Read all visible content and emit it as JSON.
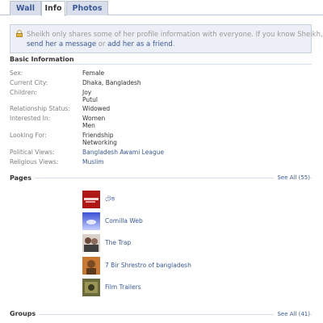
{
  "tabs": [
    {
      "label": "Wall"
    },
    {
      "label": "Info"
    },
    {
      "label": "Photos"
    }
  ],
  "notice": {
    "line1": "Sheikh only shares some of her profile information with everyone. If you know Sheikh,",
    "send_message": "send her a message",
    "or": " or ",
    "add_friend": "add her as a friend",
    "end": "."
  },
  "basic_info": {
    "title": "Basic Information",
    "rows": [
      {
        "label": "Sex:",
        "values": [
          "Female"
        ]
      },
      {
        "label": "Current City:",
        "values": [
          "Dhaka, Bangladesh"
        ]
      },
      {
        "label": "Children:",
        "values": [
          "Joy",
          "Putul"
        ]
      },
      {
        "label": "Relationship Status:",
        "values": [
          "Widowed"
        ]
      },
      {
        "label": "Interested In:",
        "values": [
          "Women",
          "Men"
        ]
      },
      {
        "label": "Looking For:",
        "values": [
          "Friendship",
          "Networking"
        ]
      },
      {
        "label": "Political Views:",
        "values": [
          "Bangladesh Awami League"
        ]
      },
      {
        "label": "Religious Views:",
        "values": [
          "Muslim"
        ]
      }
    ]
  },
  "pages": {
    "title": "Pages",
    "see_all": "See All (55)",
    "items": [
      {
        "name": "টেক"
      },
      {
        "name": "Comilla Web"
      },
      {
        "name": "The Trap"
      },
      {
        "name": "7 Bir Shrestro of bangladesh"
      },
      {
        "name": "Film Trailers"
      }
    ]
  },
  "groups": {
    "title": "Groups",
    "see_all": "See All (41)"
  },
  "colors": {
    "link": "#3b5998",
    "tab_bg": "#d8dfea",
    "label_gray": "#808080"
  }
}
